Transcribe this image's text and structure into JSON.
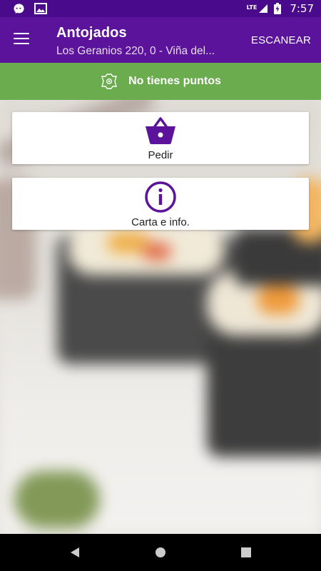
{
  "status_bar": {
    "time": "7:57",
    "network_label": "LTE",
    "icons": [
      "messenger-icon",
      "gallery-icon",
      "signal-icon",
      "battery-icon"
    ]
  },
  "app_bar": {
    "title": "Antojados",
    "subtitle": "Los Geranios 220, 0 - Viña del...",
    "scan_label": "ESCANEAR",
    "menu_icon": "hamburger-menu-icon"
  },
  "points": {
    "text": "No tienes puntos",
    "icon": "badge-icon"
  },
  "actions": [
    {
      "label": "Pedir",
      "icon": "basket-icon"
    },
    {
      "label": "Carta e info.",
      "icon": "info-icon"
    }
  ],
  "colors": {
    "status_bar": "#4a0a8c",
    "app_bar": "#5b139b",
    "accent": "#5b139b",
    "points_bar": "#6aac4e",
    "card_bg": "#ffffff"
  },
  "nav_bar": {
    "icons": [
      "back-icon",
      "home-icon",
      "recents-icon"
    ]
  }
}
